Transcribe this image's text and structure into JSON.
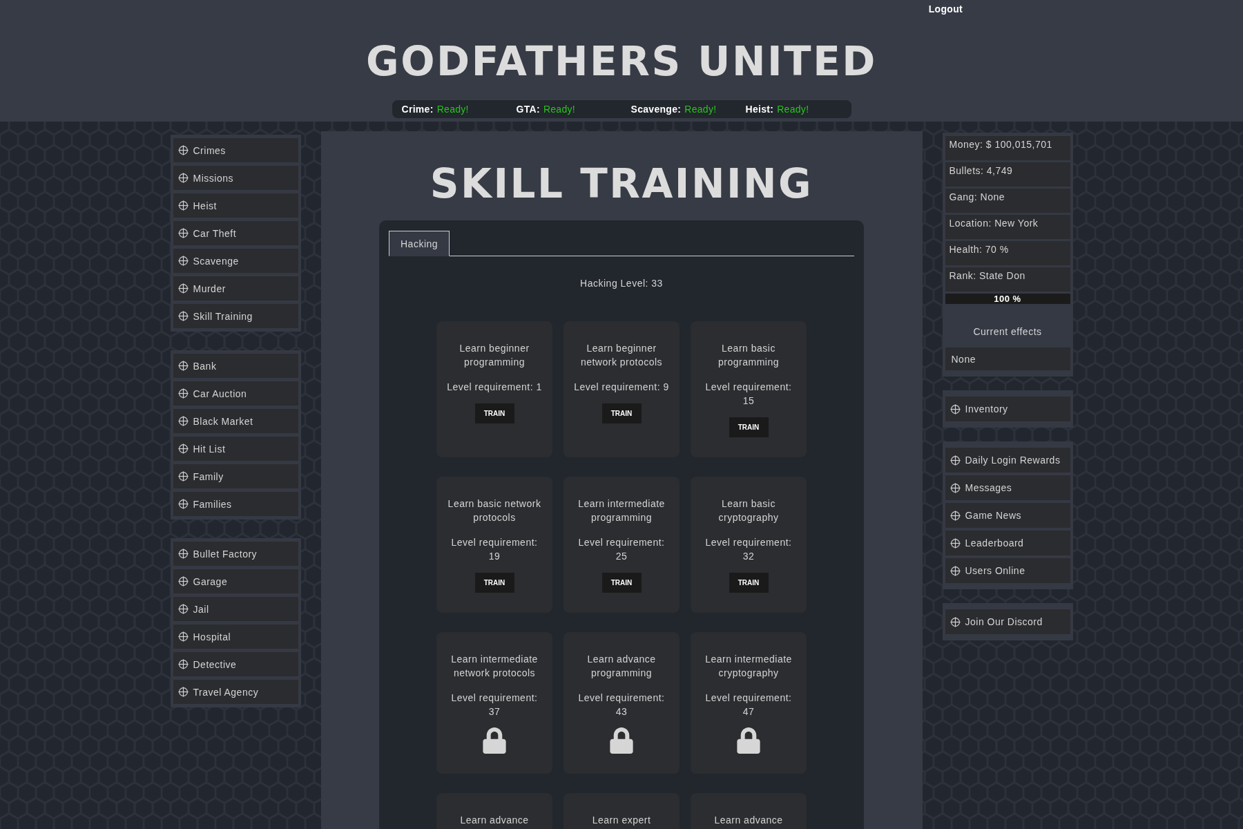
{
  "header": {
    "logout": "Logout",
    "title": "GODFATHERS UNITED",
    "timers": [
      {
        "label": "Crime:",
        "status": "Ready!"
      },
      {
        "label": "GTA:",
        "status": "Ready!"
      },
      {
        "label": "Scavenge:",
        "status": "Ready!"
      },
      {
        "label": "Heist:",
        "status": "Ready!"
      }
    ]
  },
  "left_menu": [
    {
      "items": [
        "Crimes",
        "Missions",
        "Heist",
        "Car Theft",
        "Scavenge",
        "Murder",
        "Skill Training"
      ]
    },
    {
      "items": [
        "Bank",
        "Car Auction",
        "Black Market",
        "Hit List",
        "Family",
        "Families"
      ]
    },
    {
      "items": [
        "Bullet Factory",
        "Garage",
        "Jail",
        "Hospital",
        "Detective",
        "Travel Agency"
      ]
    }
  ],
  "main": {
    "title": "SKILL TRAINING",
    "tabs": [
      {
        "label": "Hacking",
        "selected": true
      }
    ],
    "level": "Hacking Level: 33",
    "skills": [
      {
        "title": "Learn beginner programming",
        "requirement": "Level requirement: 1",
        "kind": "trainable",
        "button": "TRAIN"
      },
      {
        "title": "Learn beginner network protocols",
        "requirement": "Level requirement: 9",
        "kind": "trainable",
        "button": "TRAIN"
      },
      {
        "title": "Learn basic programming",
        "requirement": "Level requirement: 15",
        "kind": "trainable",
        "button": "TRAIN"
      },
      {
        "title": "Learn basic network protocols",
        "requirement": "Level requirement: 19",
        "kind": "trainable",
        "button": "TRAIN"
      },
      {
        "title": "Learn intermediate programming",
        "requirement": "Level requirement: 25",
        "kind": "trainable",
        "button": "TRAIN"
      },
      {
        "title": "Learn basic cryptography",
        "requirement": "Level requirement: 32",
        "kind": "trainable",
        "button": "TRAIN"
      },
      {
        "title": "Learn intermediate network protocols",
        "requirement": "Level requirement: 37",
        "kind": "locked"
      },
      {
        "title": "Learn advance programming",
        "requirement": "Level requirement: 43",
        "kind": "locked"
      },
      {
        "title": "Learn intermediate cryptography",
        "requirement": "Level requirement: 47",
        "kind": "locked"
      },
      {
        "title": "Learn advance"
      },
      {
        "title": "Learn expert"
      },
      {
        "title": "Learn advance"
      }
    ]
  },
  "stats": {
    "rows": [
      "Money: $ 100,015,701",
      "Bullets: 4,749",
      "Gang: None",
      "Location: New York",
      "Health: 70 %",
      "Rank: State Don"
    ],
    "rank_progress": {
      "level": 1,
      "reading": "100 %"
    },
    "effects_title": "Current effects",
    "effects": [
      "None"
    ]
  },
  "right_menu": [
    {
      "items": [
        "Inventory"
      ]
    },
    {
      "items": [
        "Daily Login Rewards",
        "Messages",
        "Game News",
        "Leaderboard",
        "Users Online"
      ]
    },
    {
      "items": [
        "Join Our Discord"
      ]
    }
  ]
}
